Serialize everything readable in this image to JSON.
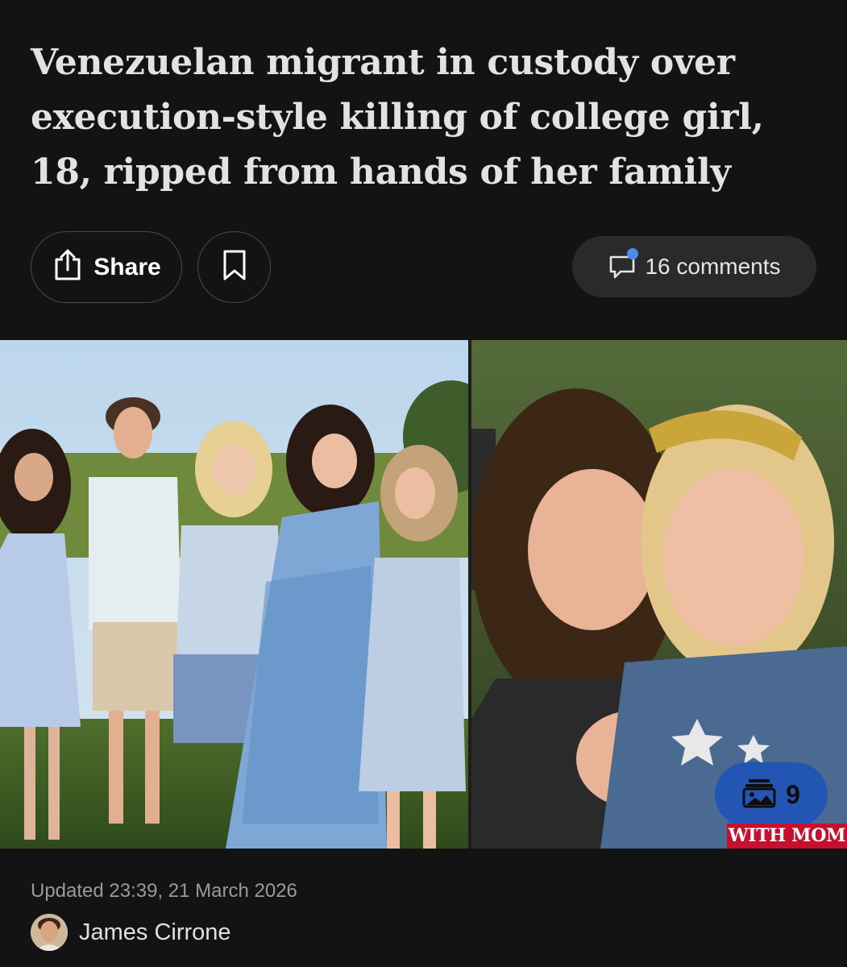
{
  "article": {
    "headline": "Venezuelan migrant in custody over execution-style killing of college girl, 18, ripped from hands of her family",
    "updated": "Updated 23:39, 21 March 2026",
    "author": "James Cirrone"
  },
  "actions": {
    "share_label": "Share",
    "share_icon": "share-icon",
    "bookmark_icon": "bookmark-icon",
    "comments_label": "16 comments",
    "comments_icon": "comment-bubble-icon",
    "notification_dot_color": "#4f8ae6"
  },
  "media": {
    "gallery_count": "9",
    "gallery_icon": "photo-gallery-icon",
    "caption_tag": "WITH MOM",
    "badge_color": "#2356b4",
    "caption_color": "#c8102e"
  }
}
